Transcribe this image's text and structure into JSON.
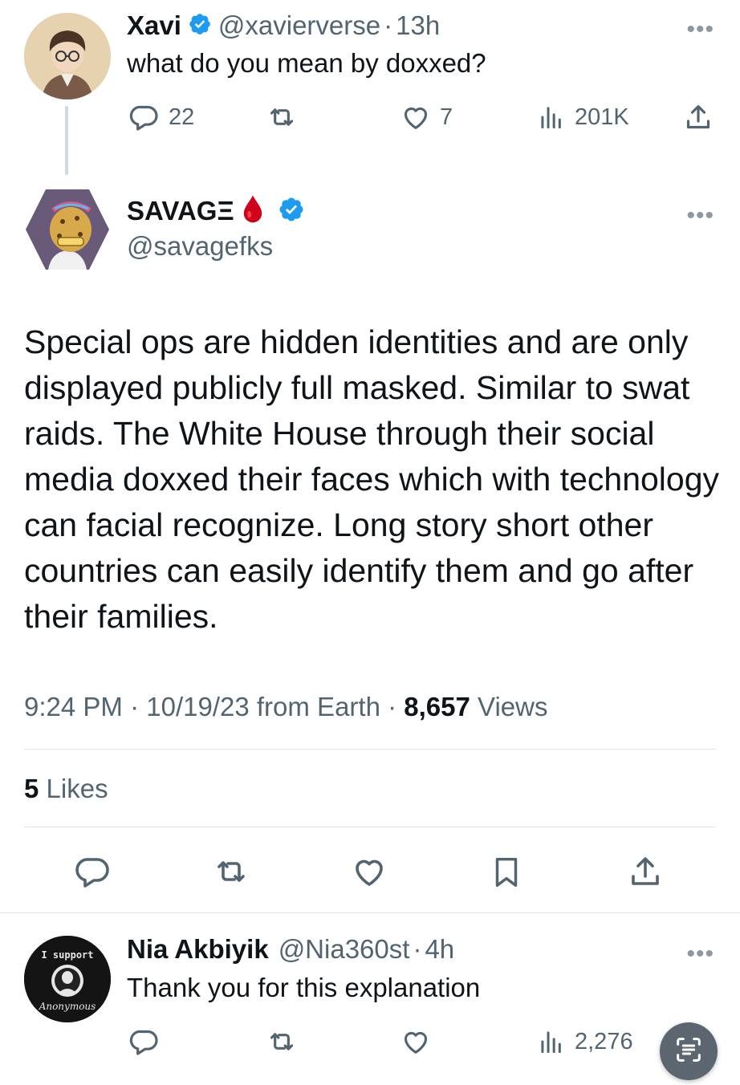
{
  "tweet1": {
    "name": "Xavi",
    "handle": "@xavierverse",
    "time": "13h",
    "text": "what do you mean by doxxed?",
    "replies": "22",
    "retweets": "",
    "likes": "7",
    "views": "201K",
    "verified_color": "#1d9bf0"
  },
  "tweet2": {
    "name": "SAVAGΞ",
    "emoji": "🩸",
    "handle": "@savagefks",
    "text": "Special ops are hidden identities and are only displayed publicly full masked. Similar to swat raids. The White House through their social media doxxed their faces which with technology can facial recognize. Long story short other countries can easily identify them and go after their families.",
    "time": "9:24 PM",
    "date": "10/19/23",
    "source": "from Earth",
    "views_count": "8,657",
    "views_label": "Views",
    "likes_count": "5",
    "likes_label": "Likes"
  },
  "tweet3": {
    "name": "Nia Akbiyik",
    "handle": "@Nia360st",
    "time": "4h",
    "text": "Thank you for this explanation",
    "views": "2,276",
    "avatar_text_top": "I support",
    "avatar_text_bottom": "Anonymous"
  },
  "separator": "·",
  "more_glyph": "•••",
  "icons": [
    "reply-icon",
    "retweet-icon",
    "like-icon",
    "views-icon",
    "share-icon",
    "bookmark-icon",
    "verified-badge-icon",
    "more-icon",
    "reader-icon"
  ],
  "colors": {
    "accent": "#1d9bf0",
    "muted": "#536471",
    "text": "#0f1419"
  }
}
